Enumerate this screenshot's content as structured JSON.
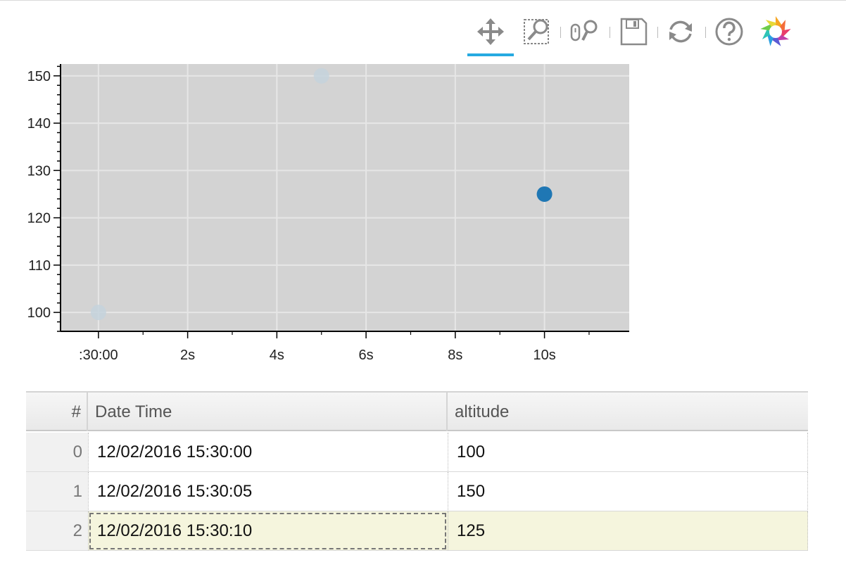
{
  "toolbar": {
    "tools": [
      {
        "name": "pan-tool",
        "icon": "move-arrows-icon",
        "active": true
      },
      {
        "name": "box-zoom-tool",
        "icon": "box-zoom-icon",
        "active": false
      },
      {
        "name": "wheel-zoom-tool",
        "icon": "wheel-zoom-icon",
        "active": false
      },
      {
        "name": "save-tool",
        "icon": "save-floppy-icon",
        "active": false
      },
      {
        "name": "reset-tool",
        "icon": "reset-refresh-icon",
        "active": false
      },
      {
        "name": "help-tool",
        "icon": "help-question-icon",
        "active": false
      },
      {
        "name": "bokeh-logo",
        "icon": "bokeh-logo-icon",
        "active": false
      }
    ],
    "accent": "#26aae1"
  },
  "chart_data": {
    "type": "scatter",
    "x": [
      "12/02/2016 15:30:00",
      "12/02/2016 15:30:05",
      "12/02/2016 15:30:10"
    ],
    "y": [
      100,
      150,
      125
    ],
    "x_tick_labels": [
      ":30:00",
      "2s",
      "4s",
      "6s",
      "8s",
      "10s"
    ],
    "y_tick_labels": [
      "100",
      "110",
      "120",
      "130",
      "140",
      "150"
    ],
    "xlim_seconds": [
      -0.85,
      11.9
    ],
    "ylim": [
      96,
      152.5
    ],
    "selected_index": 2,
    "grid": true,
    "legend": "none",
    "colors": {
      "background": "#d3d3d3",
      "grid": "#e6e6e6",
      "point": "#1f77b4",
      "point_unselected": "#c4d2dc"
    }
  },
  "table": {
    "columns": [
      "#",
      "Date Time",
      "altitude"
    ],
    "rows": [
      {
        "index": "0",
        "datetime": "12/02/2016 15:30:00",
        "altitude": "100"
      },
      {
        "index": "1",
        "datetime": "12/02/2016 15:30:05",
        "altitude": "150"
      },
      {
        "index": "2",
        "datetime": "12/02/2016 15:30:10",
        "altitude": "125"
      }
    ],
    "selected_row": 2
  }
}
